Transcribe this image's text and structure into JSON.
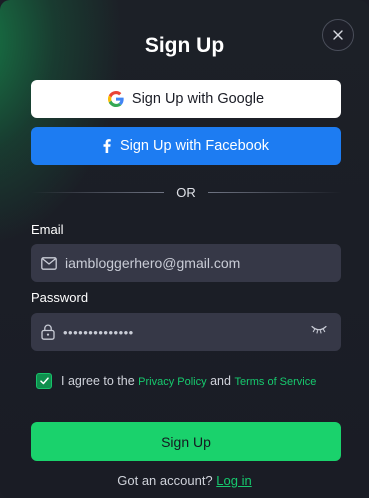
{
  "dialog": {
    "title": "Sign Up",
    "close_icon": "close-icon"
  },
  "social": {
    "google_label": "Sign Up with Google",
    "google_icon": "google-icon",
    "facebook_label": "Sign Up with Facebook",
    "facebook_icon": "facebook-icon"
  },
  "divider": {
    "text": "OR"
  },
  "form": {
    "email_label": "Email",
    "email_value": "iambloggerhero@gmail.com",
    "email_icon": "mail-icon",
    "password_label": "Password",
    "password_masked": "••••••••••••••",
    "password_icon": "lock-icon",
    "toggle_icon": "eye-closed-icon"
  },
  "agree": {
    "checked": true,
    "prefix": "I agree to the",
    "privacy_link": "Privacy Policy",
    "middle": "and",
    "terms_link": "Terms of Service"
  },
  "submit": {
    "label": "Sign Up"
  },
  "footer": {
    "question": "Got an account?",
    "login_link": "Log in"
  },
  "colors": {
    "accent_green": "#1ad26c",
    "facebook_blue": "#1d7cf2",
    "background": "#1b1d26",
    "input_background": "#363847"
  }
}
